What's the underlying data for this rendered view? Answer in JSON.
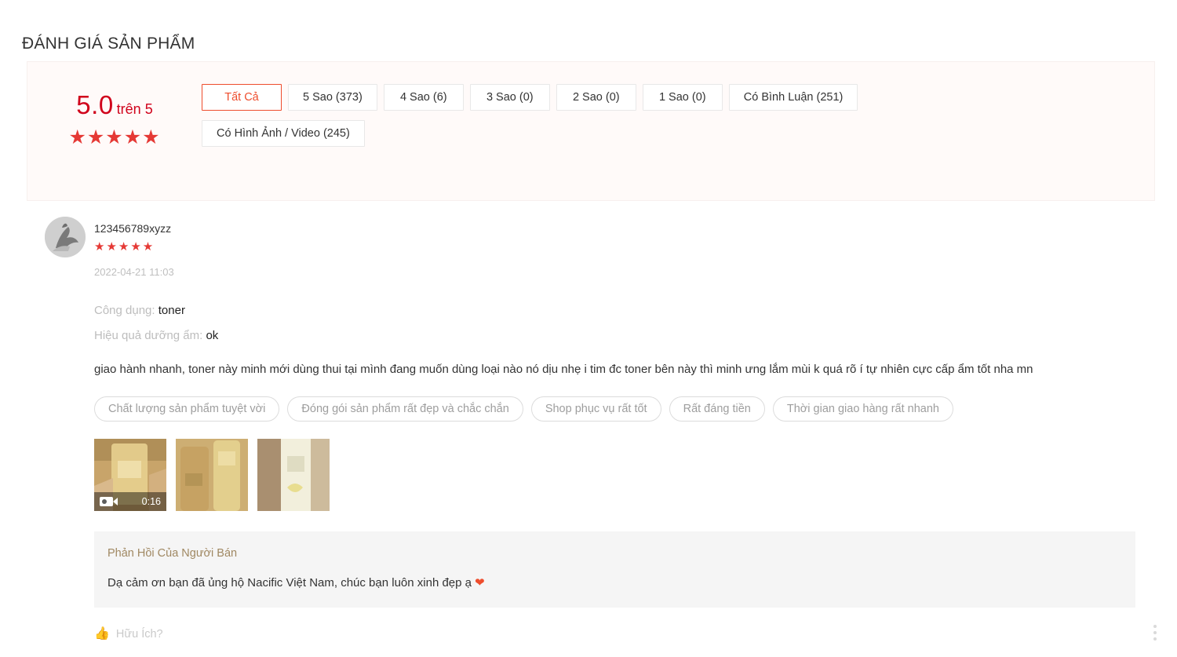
{
  "section": {
    "title": "ĐÁNH GIÁ SẢN PHẨM"
  },
  "summary": {
    "score": "5.0",
    "score_suffix": "trên 5",
    "stars": "★★★★★",
    "filters_row1": [
      {
        "label": "Tất Cả",
        "active": true
      },
      {
        "label": "5 Sao (373)",
        "active": false
      },
      {
        "label": "4 Sao (6)",
        "active": false
      },
      {
        "label": "3 Sao (0)",
        "active": false
      },
      {
        "label": "2 Sao (0)",
        "active": false
      },
      {
        "label": "1 Sao (0)",
        "active": false
      },
      {
        "label": "Có Bình Luận (251)",
        "active": false
      }
    ],
    "filters_row2": [
      {
        "label": "Có Hình Ảnh / Video (245)",
        "active": false
      }
    ]
  },
  "review": {
    "username": "123456789xyzz",
    "stars": "★★★★★",
    "date": "2022-04-21 11:03",
    "attributes": [
      {
        "label": "Công dụng:",
        "value": "toner"
      },
      {
        "label": "Hiệu quả dưỡng ẩm:",
        "value": "ok"
      }
    ],
    "text": "giao hành nhanh, toner này minh mới dùng thui tại mình đang muốn dùng loại nào nó dịu nhẹ i tim đc toner bên này thì minh ưng lắm mùi k quá rõ í tự nhiên cực cấp ẩm tốt nha mn",
    "tags": [
      "Chất lượng sản phẩm tuyệt vời",
      "Đóng gói sản phẩm rất đẹp và chắc chắn",
      "Shop phục vụ rất tốt",
      "Rất đáng tiền",
      "Thời gian giao hàng rất nhanh"
    ],
    "media": [
      {
        "type": "video",
        "duration": "0:16"
      },
      {
        "type": "image",
        "duration": ""
      },
      {
        "type": "image",
        "duration": ""
      }
    ],
    "seller_reply": {
      "title": "Phản Hồi Của Người Bán",
      "text": "Dạ cảm ơn bạn đã ủng hộ Nacific Việt Nam, chúc bạn luôn xinh đẹp ạ",
      "emoji": "❤"
    },
    "useful_label": "Hữu Ích?"
  },
  "colors": {
    "accent": "#ee4d2d",
    "star": "#e53935",
    "score": "#d0021b",
    "summary_bg": "#fffaf9",
    "reply_bg": "#f5f5f5",
    "reply_title": "#a08862"
  }
}
